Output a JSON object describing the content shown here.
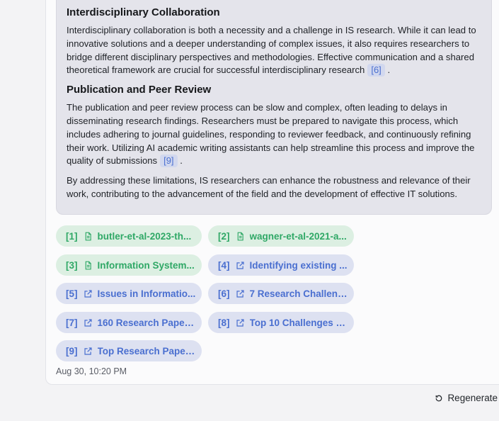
{
  "answer": {
    "sections": [
      {
        "heading": "Interdisciplinary Collaboration",
        "text": "Interdisciplinary collaboration is both a necessity and a challenge in IS research. While it can lead to innovative solutions and a deeper understanding of complex issues, it also requires researchers to bridge different disciplinary perspectives and methodologies. Effective communication and a shared theoretical framework are crucial for successful interdisciplinary research",
        "citation": "[6]",
        "tail": "."
      },
      {
        "heading": "Publication and Peer Review",
        "text": "The publication and peer review process can be slow and complex, often leading to delays in disseminating research findings. Researchers must be prepared to navigate this process, which includes adhering to journal guidelines, responding to reviewer feedback, and continuously refining their work. Utilizing AI academic writing assistants can help streamline this process and improve the quality of submissions",
        "citation": "[9]",
        "tail": "."
      }
    ],
    "conclusion": "By addressing these limitations, IS researchers can enhance the robustness and relevance of their work, contributing to the advancement of the field and the development of effective IT solutions."
  },
  "sources": [
    {
      "num": "[1]",
      "type": "file",
      "icon": "document-icon",
      "title": "butler-et-al-2023-th..."
    },
    {
      "num": "[2]",
      "type": "file",
      "icon": "document-icon",
      "title": "wagner-et-al-2021-a..."
    },
    {
      "num": "[3]",
      "type": "file",
      "icon": "document-icon",
      "title": "Information System..."
    },
    {
      "num": "[4]",
      "type": "link",
      "icon": "external-link-icon",
      "title": "Identifying existing ..."
    },
    {
      "num": "[5]",
      "type": "link",
      "icon": "external-link-icon",
      "title": "Issues in Informatio..."
    },
    {
      "num": "[6]",
      "type": "link",
      "icon": "external-link-icon",
      "title": "7 Research Challeng..."
    },
    {
      "num": "[7]",
      "type": "link",
      "icon": "external-link-icon",
      "title": "160 Research Paper ..."
    },
    {
      "num": "[8]",
      "type": "link",
      "icon": "external-link-icon",
      "title": "Top 10 Challenges F..."
    },
    {
      "num": "[9]",
      "type": "link",
      "icon": "external-link-icon",
      "title": "Top Research Paper ..."
    }
  ],
  "timestamp": "Aug 30, 10:20 PM",
  "actions": {
    "regenerate_label": "Regenerate",
    "regenerate_icon": "refresh-icon"
  },
  "colors": {
    "file_chip_text": "#2fa866",
    "file_chip_bg": "#dcefe2",
    "link_chip_text": "#4a6fd0",
    "link_chip_bg": "#dde1f1"
  }
}
